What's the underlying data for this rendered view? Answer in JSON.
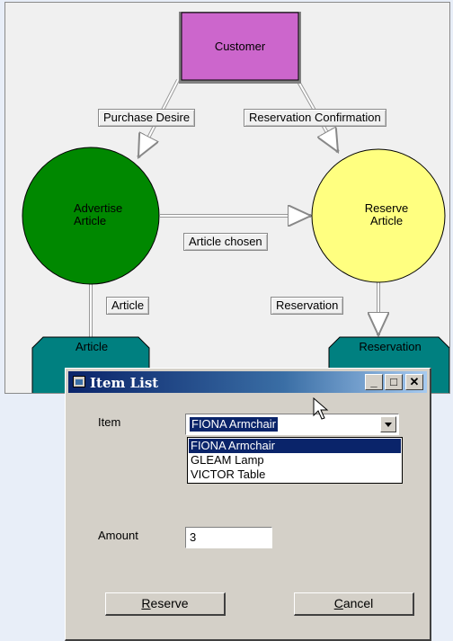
{
  "diagram": {
    "nodes": {
      "customer": "Customer",
      "advertise_article": "Advertise\nArticle",
      "reserve_article": "Reserve\nArticle",
      "article_store": "Article",
      "reservation_store": "Reservation"
    },
    "flows": {
      "purchase_desire": "Purchase Desire",
      "reservation_confirmation": "Reservation Confirmation",
      "article_chosen": "Article chosen",
      "article": "Article",
      "reservation": "Reservation"
    },
    "colors": {
      "customer": "#cc66cc",
      "advertise": "#008800",
      "reserve": "#ffff80",
      "store": "#008080"
    }
  },
  "dialog": {
    "title": "Item List",
    "item_label": "Item",
    "item_selected": "FIONA Armchair",
    "options": [
      "FIONA Armchair",
      "GLEAM Lamp",
      "VICTOR Table"
    ],
    "amount_label": "Amount",
    "amount_value": "3",
    "reserve_label": "Reserve",
    "cancel_label": "Cancel",
    "minimize_glyph": "_",
    "maximize_glyph": "□",
    "close_glyph": "✕"
  }
}
